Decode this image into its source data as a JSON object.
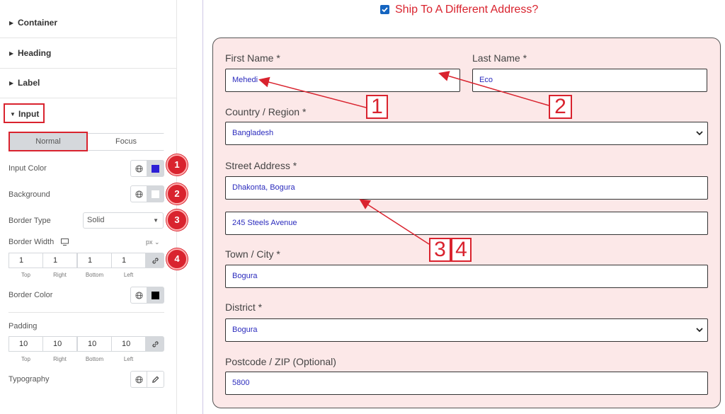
{
  "panel": {
    "sections": [
      {
        "label": "Container"
      },
      {
        "label": "Heading"
      },
      {
        "label": "Label"
      }
    ],
    "active_section": "Input",
    "tabs": {
      "normal": "Normal",
      "focus": "Focus"
    },
    "controls": {
      "input_color": {
        "label": "Input Color",
        "color": "#2d1fd6"
      },
      "background": {
        "label": "Background",
        "color": "#ffffff"
      },
      "border_type": {
        "label": "Border Type",
        "value": "Solid"
      },
      "border_width": {
        "label": "Border Width",
        "unit": "px",
        "values": [
          "1",
          "1",
          "1",
          "1"
        ],
        "sides": [
          "Top",
          "Right",
          "Bottom",
          "Left"
        ]
      },
      "border_color": {
        "label": "Border Color",
        "color": "#000000"
      },
      "padding": {
        "label": "Padding",
        "values": [
          "10",
          "10",
          "10",
          "10"
        ],
        "sides": [
          "Top",
          "Right",
          "Bottom",
          "Left"
        ]
      },
      "typography": {
        "label": "Typography"
      }
    },
    "badges": [
      "1",
      "2",
      "3",
      "4"
    ]
  },
  "form": {
    "ship_label": "Ship To A Different Address?",
    "fields": {
      "first_name": {
        "label": "First Name *",
        "value": "Mehedi"
      },
      "last_name": {
        "label": "Last Name *",
        "value": "Eco"
      },
      "country": {
        "label": "Country / Region *",
        "value": "Bangladesh"
      },
      "street": {
        "label": "Street Address *",
        "value": "Dhakonta, Bogura",
        "value2": "245 Steels Avenue"
      },
      "town": {
        "label": "Town / City *",
        "value": "Bogura"
      },
      "district": {
        "label": "District *",
        "value": "Bogura"
      },
      "postcode": {
        "label": "Postcode / ZIP (Optional)",
        "value": "5800"
      }
    }
  },
  "annotations": [
    "1",
    "2",
    "3",
    "4"
  ],
  "colors": {
    "accent_red": "#d9232e",
    "card_bg": "#fce8e8",
    "input_text": "#2b2bbd"
  }
}
